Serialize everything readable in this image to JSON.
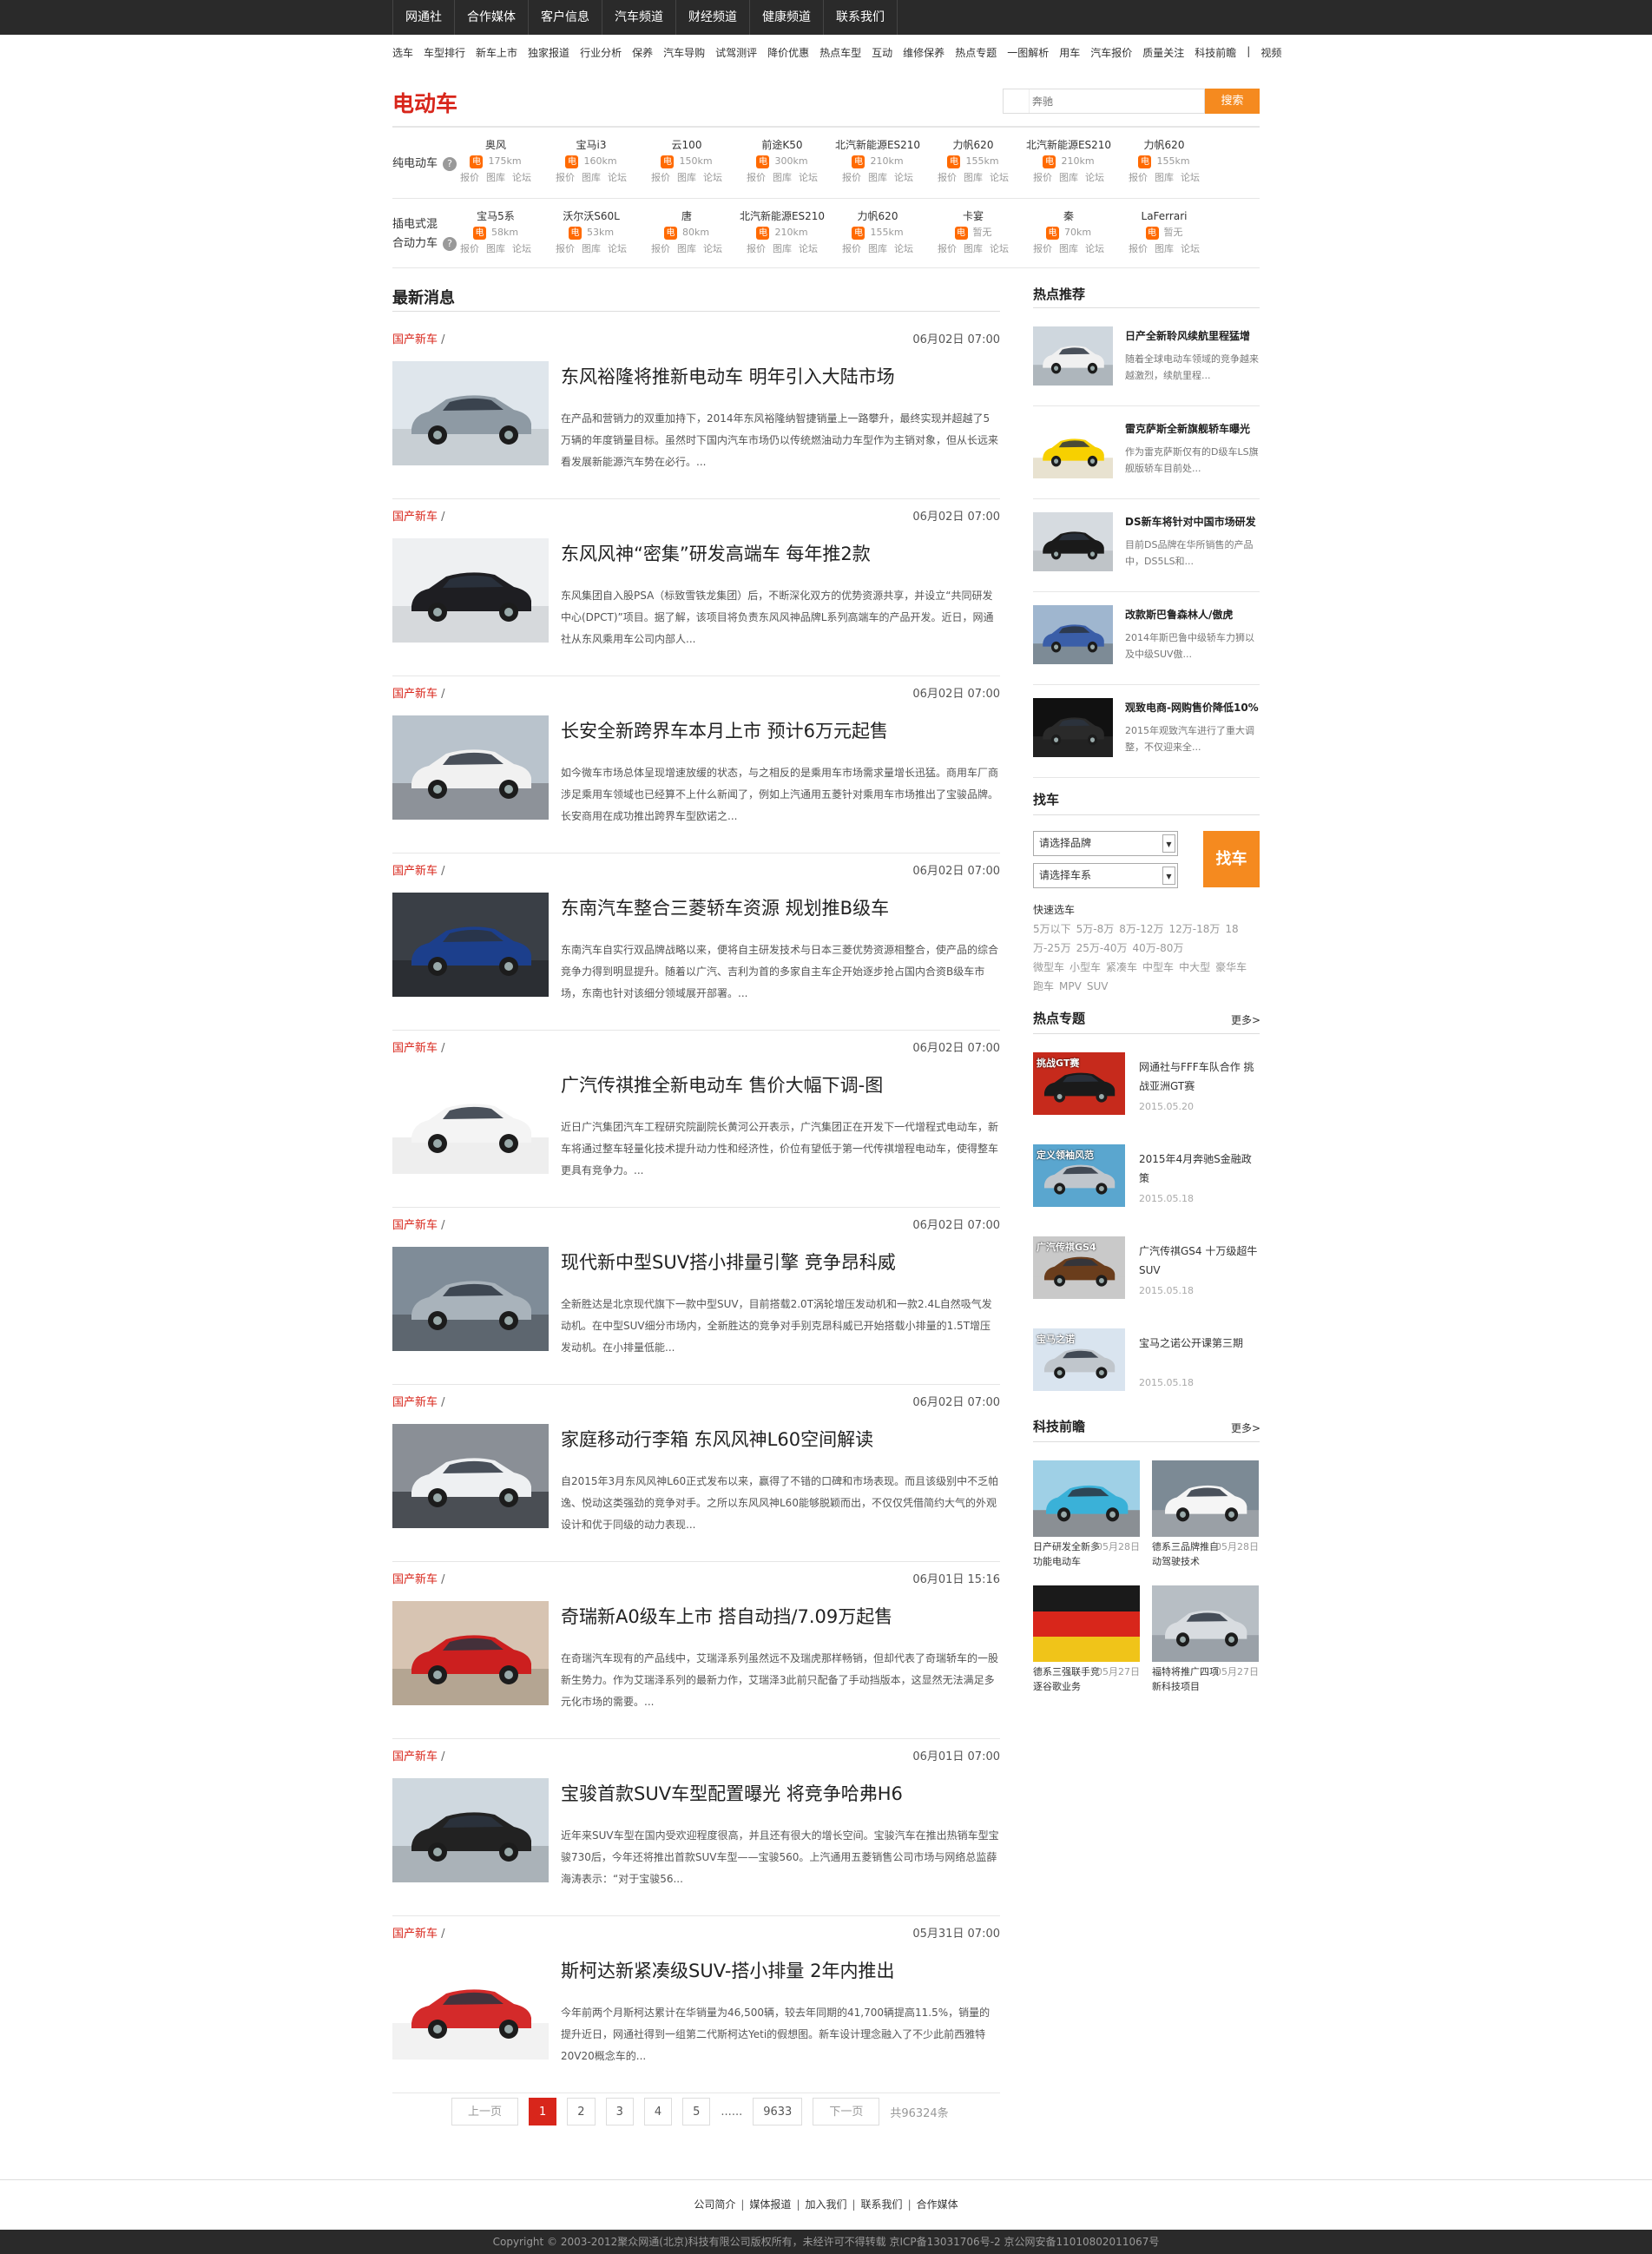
{
  "top_nav": [
    "网通社",
    "合作媒体",
    "客户信息",
    "汽车频道",
    "财经频道",
    "健康频道",
    "联系我们"
  ],
  "sub_links": [
    "选车",
    "车型排行",
    "新车上市",
    "独家报道",
    "行业分析",
    "保养",
    "汽车导购",
    "试驾测评",
    "降价优惠",
    "热点车型",
    "互动",
    "维修保养",
    "热点专题",
    "一图解析",
    "用车",
    "汽车报价",
    "质量关注",
    "科技前瞻",
    "|",
    "视频"
  ],
  "header": {
    "title": "电动车",
    "search_placeholder": "奔驰",
    "search_button": "搜索"
  },
  "car_table": {
    "rows": [
      {
        "label": "纯电动车",
        "cars": [
          {
            "name": "奥风",
            "range": "175km"
          },
          {
            "name": "宝马i3",
            "range": "160km"
          },
          {
            "name": "云100",
            "range": "150km"
          },
          {
            "name": "前途K50",
            "range": "300km"
          },
          {
            "name": "北汽新能源ES210",
            "range": "210km"
          },
          {
            "name": "力帆620",
            "range": "155km"
          },
          {
            "name": "北汽新能源ES210",
            "range": "210km"
          },
          {
            "name": "力帆620",
            "range": "155km"
          }
        ]
      },
      {
        "label_line1": "插电式混",
        "label_line2": "合动力车",
        "cars": [
          {
            "name": "宝马5系",
            "range": "58km"
          },
          {
            "name": "沃尔沃S60L",
            "range": "53km"
          },
          {
            "name": "唐",
            "range": "80km"
          },
          {
            "name": "北汽新能源ES210",
            "range": "210km"
          },
          {
            "name": "力帆620",
            "range": "155km"
          },
          {
            "name": "卡宴",
            "range": "暂无"
          },
          {
            "name": "秦",
            "range": "70km"
          },
          {
            "name": "LaFerrari",
            "range": "暂无"
          }
        ]
      }
    ],
    "e_badge": "电",
    "links": [
      "报价",
      "图库",
      "论坛"
    ],
    "help_icon": "?"
  },
  "main": {
    "section_title": "最新消息",
    "news": [
      {
        "cat": "国产新车",
        "date": "06月02日 07:00",
        "title": "东风裕隆将推新电动车 明年引入大陆市场",
        "summary": "在产品和营销力的双重加持下，2014年东风裕隆纳智捷销量上一路攀升，最终实现并超越了5万辆的年度销量目标。虽然时下国内汽车市场仍以传统燃油动力车型作为主销对象，但从长远来看发展新能源汽车势在必行。..."
      },
      {
        "cat": "国产新车",
        "date": "06月02日 07:00",
        "title": "东风风神“密集”研发高端车 每年推2款",
        "summary": "东风集团自入股PSA（标致雪铁龙集团）后，不断深化双方的优势资源共享，并设立“共同研发中心(DPCT)”项目。据了解，该项目将负责东风风神品牌L系列高端车的产品开发。近日，网通社从东风乘用车公司内部人..."
      },
      {
        "cat": "国产新车",
        "date": "06月02日 07:00",
        "title": "长安全新跨界车本月上市 预计6万元起售",
        "summary": "如今微车市场总体呈现增速放缓的状态，与之相反的是乘用车市场需求量增长迅猛。商用车厂商涉足乘用车领域也已经算不上什么新闻了，例如上汽通用五菱针对乘用车市场推出了宝骏品牌。长安商用在成功推出跨界车型欧诺之..."
      },
      {
        "cat": "国产新车",
        "date": "06月02日 07:00",
        "title": "东南汽车整合三菱轿车资源 规划推B级车",
        "summary": "东南汽车自实行双品牌战略以来，便将自主研发技术与日本三菱优势资源相整合，使产品的综合竞争力得到明显提升。随着以广汽、吉利为首的多家自主车企开始逐步抢占国内合资B级车市场，东南也针对该细分领域展开部署。..."
      },
      {
        "cat": "国产新车",
        "date": "06月02日 07:00",
        "title": "广汽传祺推全新电动车 售价大幅下调-图",
        "summary": "近日广汽集团汽车工程研究院副院长黄河公开表示，广汽集团正在开发下一代增程式电动车，新车将通过整车轻量化技术提升动力性和经济性，价位有望低于第一代传祺增程电动车，使得整车更具有竞争力。..."
      },
      {
        "cat": "国产新车",
        "date": "06月02日 07:00",
        "title": "现代新中型SUV搭小排量引擎 竞争昂科威",
        "summary": "全新胜达是北京现代旗下一款中型SUV，目前搭载2.0T涡轮增压发动机和一款2.4L自然吸气发动机。在中型SUV细分市场内，全新胜达的竞争对手别克昂科威已开始搭载小排量的1.5T增压发动机。在小排量低能..."
      },
      {
        "cat": "国产新车",
        "date": "06月02日 07:00",
        "title": "家庭移动行李箱 东风风神L60空间解读",
        "summary": "自2015年3月东风风神L60正式发布以来，赢得了不错的口碑和市场表现。而且该级别中不乏帕逸、悦动这类强劲的竞争对手。之所以东风风神L60能够脱颖而出，不仅仅凭借简约大气的外观设计和优于同级的动力表现..."
      },
      {
        "cat": "国产新车",
        "date": "06月01日 15:16",
        "title": "奇瑞新A0级车上市 搭自动挡/7.09万起售",
        "summary": "在奇瑞汽车现有的产品线中，艾瑞泽系列虽然远不及瑞虎那样畅销，但却代表了奇瑞轿车的一股新生势力。作为艾瑞泽系列的最新力作，艾瑞泽3此前只配备了手动挡版本，这显然无法满足多元化市场的需要。..."
      },
      {
        "cat": "国产新车",
        "date": "06月01日 07:00",
        "title": "宝骏首款SUV车型配置曝光 将竞争哈弗H6",
        "summary": "近年来SUV车型在国内受欢迎程度很高，并且还有很大的增长空间。宝骏汽车在推出热销车型宝骏730后，今年还将推出首款SUV车型——宝骏560。上汽通用五菱销售公司市场与网络总监薛海涛表示：“对于宝骏56..."
      },
      {
        "cat": "国产新车",
        "date": "05月31日 07:00",
        "title": "斯柯达新紧凑级SUV-搭小排量 2年内推出",
        "summary": "今年前两个月斯柯达累计在华销量为46,500辆，较去年同期的41,700辆提高11.5%，销量的提升近日，网通社得到一组第二代斯柯达Yeti的假想图。新车设计理念融入了不少此前西雅特20V20概念车的..."
      }
    ],
    "slash": "/",
    "pager": {
      "prev": "上一页",
      "pages": [
        "1",
        "2",
        "3",
        "4",
        "5"
      ],
      "dots": "......",
      "last": "9633",
      "next": "下一页",
      "total": "共96324条"
    }
  },
  "sidebar": {
    "hot_title": "热点推荐",
    "hot": [
      {
        "title": "日产全新聆风续航里程猛增",
        "desc": "随着全球电动车领域的竞争越来越激烈，续航里程..."
      },
      {
        "title": "雷克萨斯全新旗舰轿车曝光",
        "desc": "作为雷克萨斯仅有的D级车LS旗舰版轿车目前处..."
      },
      {
        "title": "DS新车将针对中国市场研发",
        "desc": "目前DS品牌在华所销售的产品中，DS5LS和..."
      },
      {
        "title": "改款斯巴鲁森林人/傲虎",
        "desc": "2014年斯巴鲁中级轿车力狮以及中级SUV傲..."
      },
      {
        "title": "观致电商-网购售价降低10%",
        "desc": "2015年观致汽车进行了重大调整，不仅迎来全..."
      }
    ],
    "finder": {
      "title": "找车",
      "brand_placeholder": "请选择品牌",
      "series_placeholder": "请选择车系",
      "button": "找车",
      "quick_title": "快速选车",
      "price_links": [
        "5万以下",
        "5万-8万",
        "8万-12万",
        "12万-18万",
        "18万-25万",
        "25万-40万",
        "40万-80万"
      ],
      "type_links": [
        "微型车",
        "小型车",
        "紧凑车",
        "中型车",
        "中大型",
        "豪华车",
        "跑车",
        "MPV",
        "SUV"
      ]
    },
    "topics_title": "热点专题",
    "more": "更多>",
    "topics": [
      {
        "title": "网通社与FFF车队合作 挑战亚洲GT赛",
        "date": "2015.05.20",
        "thumb_text": "挑战GT赛"
      },
      {
        "title": "2015年4月奔驰S金融政策",
        "date": "2015.05.18",
        "thumb_text": "定义领袖风范"
      },
      {
        "title": "广汽传祺GS4 十万级超牛SUV",
        "date": "2015.05.18",
        "thumb_text": "广汽传祺GS4"
      },
      {
        "title": "宝马之诺公开课第三期",
        "date": "2015.05.18",
        "thumb_text": "宝马之诺"
      }
    ],
    "tech_title": "科技前瞻",
    "tech": [
      {
        "title": "日产研发全新多功能电动车",
        "date": "05月28日"
      },
      {
        "title": "德系三品牌推自动驾驶技术",
        "date": "05月28日"
      },
      {
        "title": "德系三强联手竞逐谷歌业务",
        "date": "05月27日"
      },
      {
        "title": "福特将推广四项新科技项目",
        "date": "05月27日"
      }
    ]
  },
  "footer": {
    "links": [
      "公司简介",
      "媒体报道",
      "加入我们",
      "联系我们",
      "合作媒体"
    ],
    "copyright": "Copyright © 2003-2012聚众网通(北京)科技有限公司版权所有，未经许可不得转载 京ICP备13031706号-2 京公网安备11010802011067号"
  },
  "colors": {
    "accent": "#d8261b",
    "orange": "#f58a1f",
    "dark": "#2a2a2a"
  }
}
